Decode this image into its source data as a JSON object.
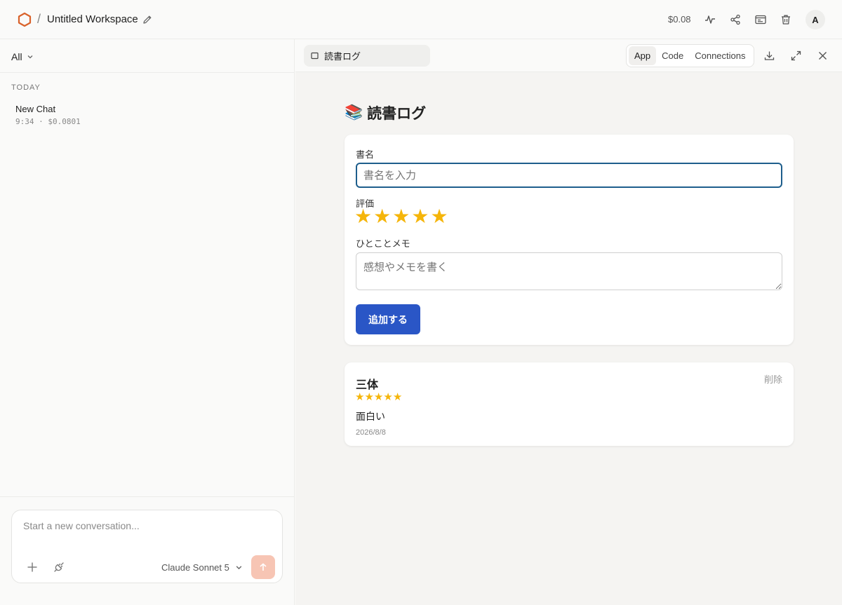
{
  "topbar": {
    "workspace_title": "Untitled Workspace",
    "separator": "/",
    "cost": "$0.08",
    "avatar_initial": "A"
  },
  "sidebar": {
    "filter_label": "All",
    "section_label": "TODAY",
    "chats": [
      {
        "title": "New Chat",
        "meta": "9:34 · $0.0801"
      }
    ],
    "composer": {
      "placeholder": "Start a new conversation...",
      "model": "Claude Sonnet 5"
    }
  },
  "panel": {
    "file_tab": "読書ログ",
    "tabs": [
      {
        "label": "App",
        "active": true
      },
      {
        "label": "Code",
        "active": false
      },
      {
        "label": "Connections",
        "active": false
      }
    ]
  },
  "app": {
    "title_emoji": "📚",
    "title": "読書ログ",
    "form": {
      "title_label": "書名",
      "title_placeholder": "書名を入力",
      "rating_label": "評価",
      "rating": 5,
      "rating_max": 5,
      "memo_label": "ひとことメモ",
      "memo_placeholder": "感想やメモを書く",
      "submit_label": "追加する"
    },
    "entries": [
      {
        "title": "三体",
        "rating": 5,
        "memo": "面白い",
        "date": "2026/8/8",
        "delete_label": "削除"
      }
    ]
  },
  "colors": {
    "accent": "#2a56c6",
    "star": "#f5b50a",
    "brand": "#d9622b",
    "send": "#f7c5b4"
  }
}
